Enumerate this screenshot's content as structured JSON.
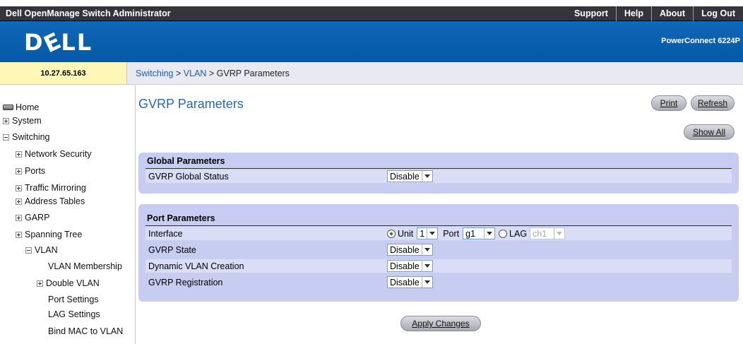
{
  "app": {
    "title": "Dell OpenManage Switch Administrator",
    "brand": "DELL",
    "product": "PowerConnect 6224P"
  },
  "topnav": [
    "Support",
    "Help",
    "About",
    "Log Out"
  ],
  "device": {
    "ip": "10.27.65.163"
  },
  "breadcrumb": {
    "l1": "Switching",
    "sep1": " > ",
    "l2": "VLAN",
    "sep2": " > ",
    "current": "GVRP Parameters"
  },
  "sidebar": {
    "home": "Home",
    "system": "System",
    "switching": "Switching",
    "network_security": "Network Security",
    "ports": "Ports",
    "traffic_mirroring": "Traffic Mirroring",
    "address_tables": "Address Tables",
    "garp": "GARP",
    "spanning_tree": "Spanning Tree",
    "vlan": "VLAN",
    "vlan_membership": "VLAN Membership",
    "double_vlan": "Double VLAN",
    "port_settings": "Port Settings",
    "lag_settings": "LAG Settings",
    "bind_mac": "Bind MAC to VLAN"
  },
  "page": {
    "title": "GVRP Parameters",
    "print": "Print",
    "refresh": "Refresh",
    "show_all": "Show All",
    "apply": "Apply Changes"
  },
  "global_params": {
    "title": "Global Parameters",
    "gvrp_status_label": "GVRP Global Status",
    "gvrp_status_value": "Disable"
  },
  "port_params": {
    "title": "Port Parameters",
    "interface_label": "Interface",
    "unit_label": "Unit",
    "unit_value": "1",
    "port_label": "Port",
    "port_value": "g1",
    "lag_label": "LAG",
    "lag_value": "ch1",
    "gvrp_state_label": "GVRP State",
    "gvrp_state_value": "Disable",
    "dyn_vlan_label": "Dynamic VLAN Creation",
    "dyn_vlan_value": "Disable",
    "gvrp_reg_label": "GVRP Registration",
    "gvrp_reg_value": "Disable"
  }
}
